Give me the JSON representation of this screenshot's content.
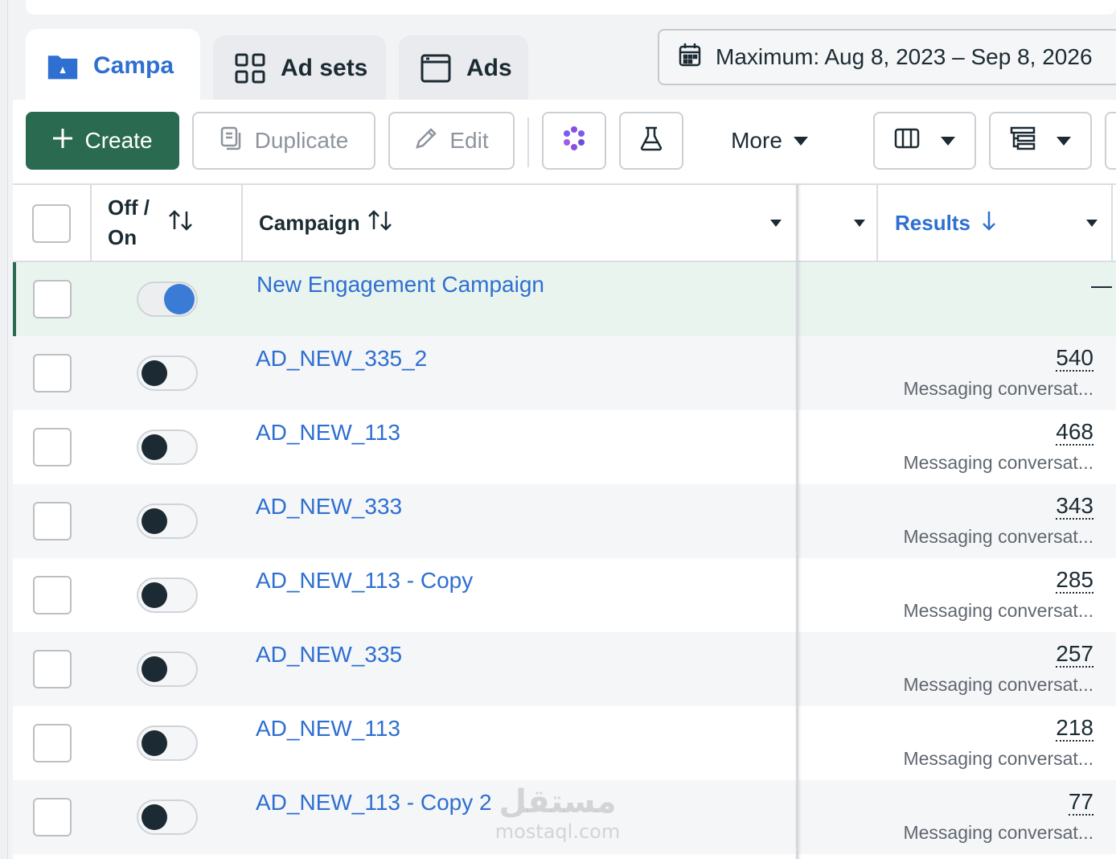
{
  "tabs": [
    {
      "label": "Campa",
      "icon": "folder-icon",
      "active": true
    },
    {
      "label": "Ad sets",
      "icon": "grid-icon",
      "active": false
    },
    {
      "label": "Ads",
      "icon": "ad-window-icon",
      "active": false
    }
  ],
  "date_range": {
    "label": "Maximum: Aug 8, 2023 – Sep 8, 2026",
    "icon": "calendar-icon"
  },
  "toolbar": {
    "create_label": "Create",
    "duplicate_label": "Duplicate",
    "edit_label": "Edit",
    "more_label": "More",
    "icons": [
      "plus-icon",
      "duplicate-icon",
      "pencil-icon",
      "sparkle-icon",
      "beaker-icon",
      "columns-icon",
      "breakdown-icon"
    ]
  },
  "table": {
    "headers": {
      "toggle": "Off /\nOn",
      "campaign": "Campaign",
      "results": "Results"
    },
    "rows": [
      {
        "name": "New Engagement Campaign",
        "on": true,
        "result": "—",
        "result_label": ""
      },
      {
        "name": "AD_NEW_335_2",
        "on": false,
        "result": "540",
        "result_label": "Messaging conversat..."
      },
      {
        "name": "AD_NEW_113",
        "on": false,
        "result": "468",
        "result_label": "Messaging conversat..."
      },
      {
        "name": "AD_NEW_333",
        "on": false,
        "result": "343",
        "result_label": "Messaging conversat..."
      },
      {
        "name": "AD_NEW_113 - Copy",
        "on": false,
        "result": "285",
        "result_label": "Messaging conversat..."
      },
      {
        "name": "AD_NEW_335",
        "on": false,
        "result": "257",
        "result_label": "Messaging conversat..."
      },
      {
        "name": "AD_NEW_113",
        "on": false,
        "result": "218",
        "result_label": "Messaging conversat..."
      },
      {
        "name": "AD_NEW_113 - Copy 2",
        "on": false,
        "result": "77",
        "result_label": "Messaging conversat..."
      }
    ]
  },
  "watermark": {
    "arabic": "مستقل",
    "latin": "mostaql.com"
  },
  "colors": {
    "accent": "#2e6fd1",
    "primary_button": "#2a6a50",
    "selected_row": "#e9f4ef",
    "toggle_on": "#3a7bd5"
  }
}
